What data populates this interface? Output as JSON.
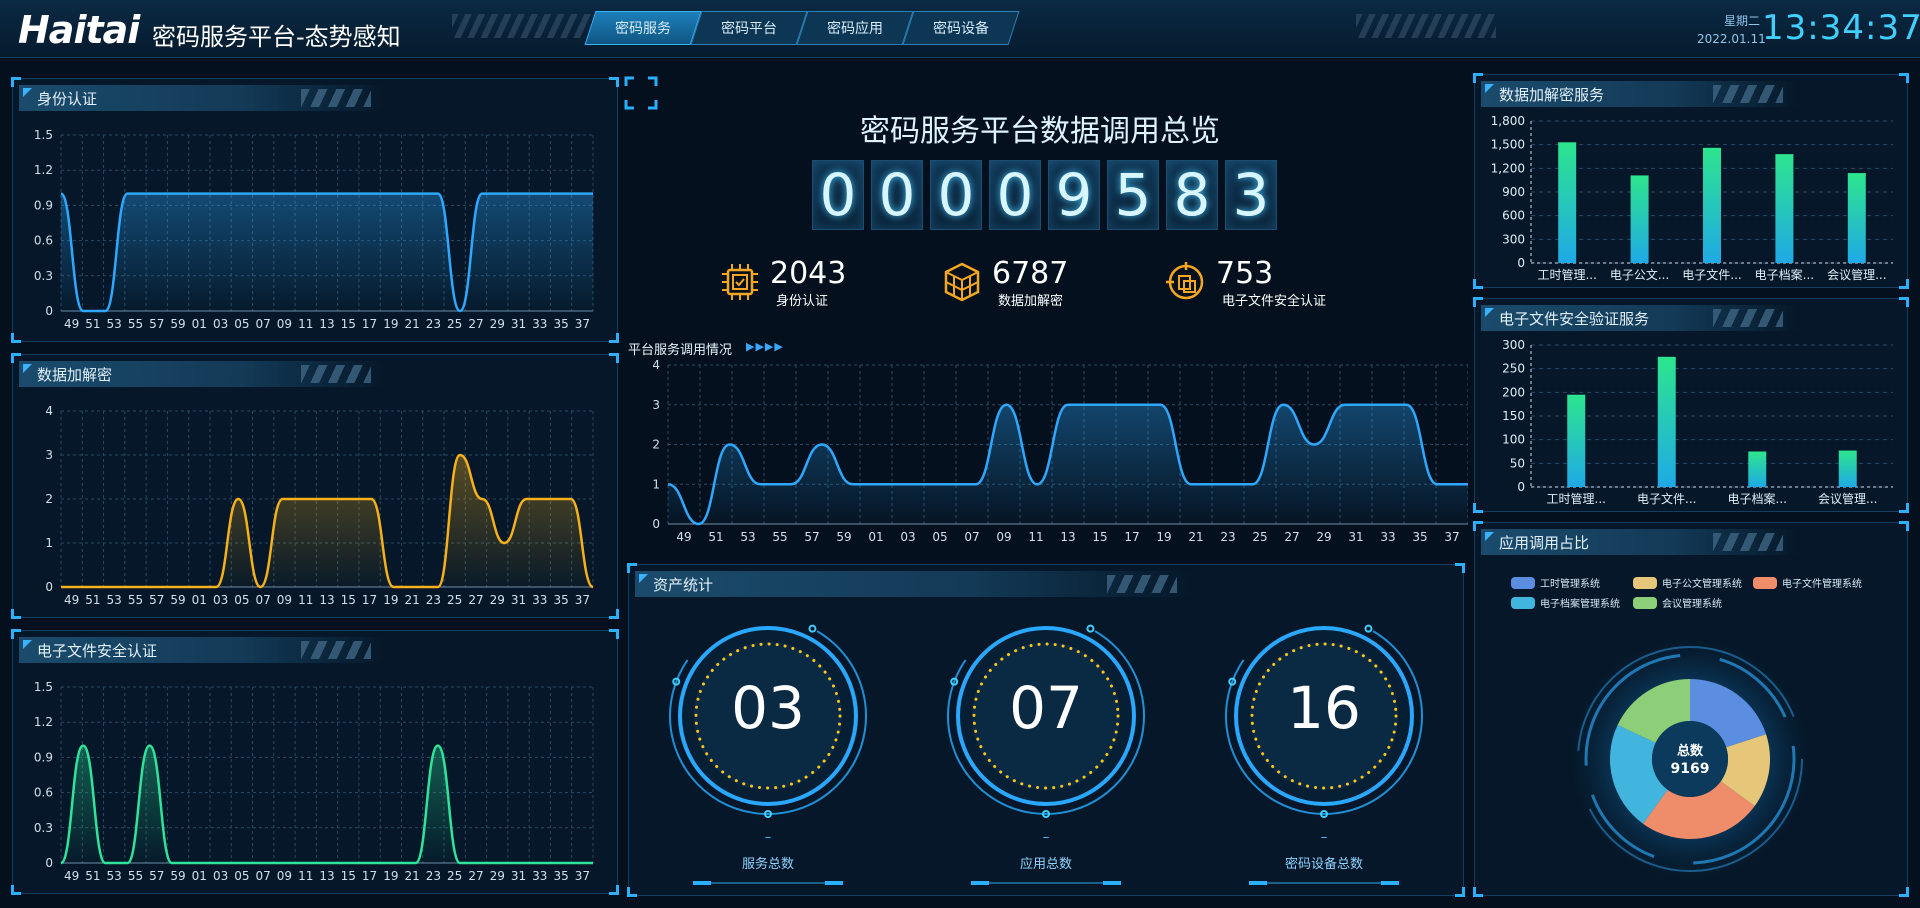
{
  "header": {
    "logo": "Haitai",
    "title": "密码服务平台-态势感知",
    "tabs": [
      {
        "label": "密码服务",
        "active": true
      },
      {
        "label": "密码平台",
        "active": false
      },
      {
        "label": "密码应用",
        "active": false
      },
      {
        "label": "密码设备",
        "active": false
      }
    ],
    "weekday": "星期二",
    "date": "2022.01.11",
    "time": "13:34:37"
  },
  "xticks": [
    "49",
    "51",
    "53",
    "55",
    "57",
    "59",
    "01",
    "03",
    "05",
    "07",
    "09",
    "11",
    "13",
    "15",
    "17",
    "19",
    "21",
    "23",
    "25",
    "27",
    "29",
    "31",
    "33",
    "35",
    "37"
  ],
  "left_panels": [
    {
      "title": "身份认证",
      "color": "#2ea8ff",
      "ymax": 1.5,
      "yticks": [
        "1.5",
        "1.2",
        "0.9",
        "0.6",
        "0.3",
        "0"
      ],
      "values": [
        1,
        0,
        0,
        1,
        1,
        1,
        1,
        1,
        1,
        1,
        1,
        1,
        1,
        1,
        1,
        1,
        1,
        1,
        0,
        1,
        1,
        1,
        1,
        1,
        1
      ]
    },
    {
      "title": "数据加解密",
      "color": "#f5b01a",
      "ymax": 4,
      "yticks": [
        "4",
        "3",
        "2",
        "1",
        "0"
      ],
      "values": [
        0,
        0,
        0,
        0,
        0,
        0,
        0,
        0,
        2,
        0,
        2,
        2,
        2,
        2,
        2,
        0,
        0,
        0,
        3,
        2,
        1,
        2,
        2,
        2,
        0
      ]
    },
    {
      "title": "电子文件安全认证",
      "color": "#2fe39a",
      "ymax": 1.5,
      "yticks": [
        "1.5",
        "1.2",
        "0.9",
        "0.6",
        "0.3",
        "0"
      ],
      "values": [
        0,
        1,
        0,
        0,
        1,
        0,
        0,
        0,
        0,
        0,
        0,
        0,
        0,
        0,
        0,
        0,
        0,
        1,
        0,
        0,
        0,
        0,
        0,
        0,
        0
      ]
    }
  ],
  "center": {
    "title": "密码服务平台数据调用总览",
    "digits": [
      "0",
      "0",
      "0",
      "0",
      "9",
      "5",
      "8",
      "3"
    ],
    "kpis": [
      {
        "value": "2043",
        "label": "身份认证",
        "icon": "chip-icon"
      },
      {
        "value": "6787",
        "label": "数据加解密",
        "icon": "cubes-icon"
      },
      {
        "value": "753",
        "label": "电子文件安全认证",
        "icon": "target-document-icon"
      }
    ],
    "chart_caption": "平台服务调用情况",
    "chart_data": {
      "type": "area",
      "x": [
        "49",
        "51",
        "53",
        "55",
        "57",
        "59",
        "01",
        "03",
        "05",
        "07",
        "09",
        "11",
        "13",
        "15",
        "17",
        "19",
        "21",
        "23",
        "25",
        "27",
        "29",
        "31",
        "33",
        "35",
        "37"
      ],
      "values": [
        1,
        0,
        2,
        1,
        1,
        2,
        1,
        1,
        1,
        1,
        1,
        3,
        1,
        3,
        3,
        3,
        3,
        1,
        1,
        1,
        3,
        2,
        3,
        3,
        3,
        1,
        1
      ],
      "ylim": [
        0,
        4
      ],
      "yticks": [
        "4",
        "3",
        "2",
        "1",
        "0"
      ]
    }
  },
  "assets": {
    "title": "资产统计",
    "items": [
      {
        "value": "03",
        "dash": "–",
        "label": "服务总数"
      },
      {
        "value": "07",
        "dash": "–",
        "label": "应用总数"
      },
      {
        "value": "16",
        "dash": "–",
        "label": "密码设备总数"
      }
    ]
  },
  "right_panels": [
    {
      "title": "数据加解密服务",
      "chart_data": {
        "type": "bar",
        "categories": [
          "工时管理...",
          "电子公文...",
          "电子文件...",
          "电子档案...",
          "会议管理..."
        ],
        "values": [
          1530,
          1110,
          1460,
          1380,
          1140
        ],
        "ylim": [
          0,
          1800
        ],
        "yticks": [
          "1,800",
          "1,500",
          "1,200",
          "900",
          "600",
          "300",
          "0"
        ]
      }
    },
    {
      "title": "电子文件安全验证服务",
      "chart_data": {
        "type": "bar",
        "categories": [
          "工时管理...",
          "电子文件...",
          "电子档案...",
          "会议管理..."
        ],
        "values": [
          195,
          275,
          75,
          77
        ],
        "ylim": [
          0,
          300
        ],
        "yticks": [
          "300",
          "250",
          "200",
          "150",
          "100",
          "50",
          "0"
        ]
      }
    },
    {
      "title": "应用调用占比",
      "chart_data": {
        "type": "pie",
        "legend": [
          {
            "name": "工时管理系统",
            "color": "#5b8de0"
          },
          {
            "name": "电子公文管理系统",
            "color": "#e6c77a"
          },
          {
            "name": "电子文件管理系统",
            "color": "#ef8d6a"
          },
          {
            "name": "电子档案管理系统",
            "color": "#41b5dd"
          },
          {
            "name": "会议管理系统",
            "color": "#8ccf78"
          }
        ],
        "values": [
          20,
          15,
          25,
          22,
          18
        ],
        "center_label": "总数",
        "center_value": "9169"
      }
    }
  ]
}
